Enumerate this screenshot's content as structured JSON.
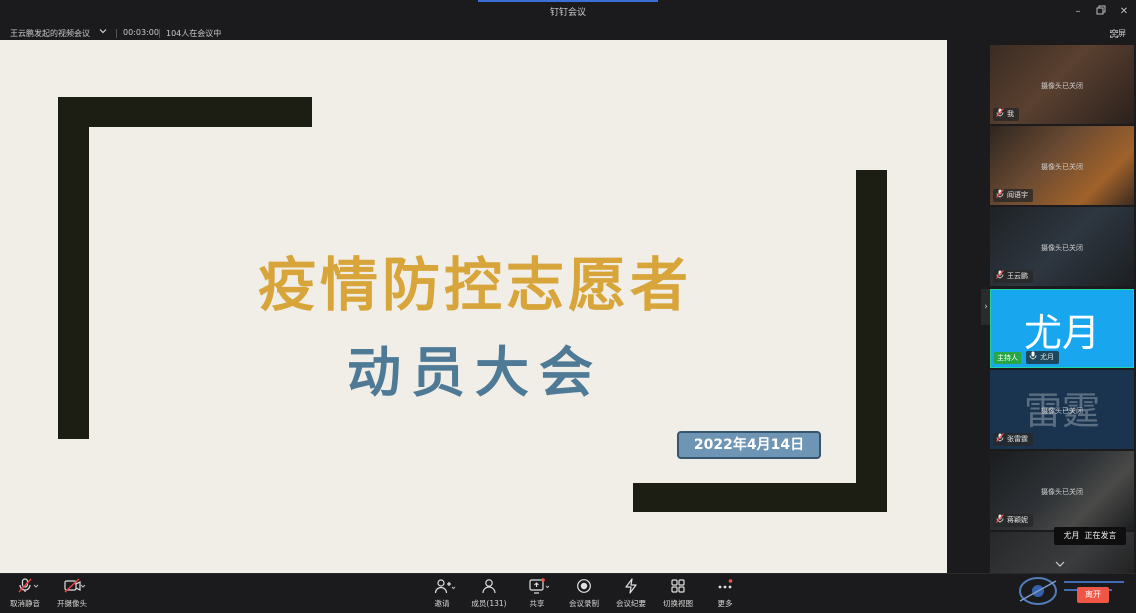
{
  "window": {
    "title": "钉钉会议",
    "fullscreen_label": "全屏"
  },
  "meeting": {
    "title": "王云鹏发起的视频会议",
    "duration": "00:03:00",
    "attendees": "104人在会议中"
  },
  "slide": {
    "title": "疫情防控志愿者",
    "subtitle": "动员大会",
    "date": "2022年4月14日",
    "colors": {
      "background": "#f0eee7",
      "bars": "#1c1d13",
      "title": "#d7a53a",
      "subtitle": "#4f7a96",
      "date_badge": "#6f95b4"
    }
  },
  "participants": [
    {
      "name": "我",
      "status": "摄像头已关闭",
      "mic": "muted"
    },
    {
      "name": "阎语宇",
      "status": "摄像头已关闭",
      "mic": "muted"
    },
    {
      "name": "王云鹏",
      "status": "摄像头已关闭",
      "mic": "muted"
    },
    {
      "name": "尤月",
      "avatar_text": "尤月",
      "role": "主持人",
      "mic": "on",
      "highlight_color": "#18a7ef"
    },
    {
      "name": "张雷霆",
      "avatar_text": "雷霆",
      "status": "摄像头已关闭",
      "mic": "muted"
    },
    {
      "name": "蒋颖妮",
      "status": "摄像头已关闭",
      "mic": "muted"
    }
  ],
  "speaking": {
    "name": "尤月",
    "status": "正在发言"
  },
  "toolbar": {
    "unmute": "取消静音",
    "camera": "开摄像头",
    "invite": "邀请",
    "members": "成员(131)",
    "share": "共享",
    "record": "会议录制",
    "minutes": "会议纪要",
    "view": "切换视图",
    "more": "更多",
    "leave": "离开"
  },
  "icons": [
    "minimize-icon",
    "restore-icon",
    "close-icon",
    "fullscreen-icon",
    "chevron-down-icon",
    "mic-muted-icon",
    "camera-off-icon",
    "invite-icon",
    "members-icon",
    "share-icon",
    "record-icon",
    "minutes-icon",
    "grid-icon",
    "more-icon",
    "chevron-right-icon"
  ],
  "accent": "#f05545"
}
